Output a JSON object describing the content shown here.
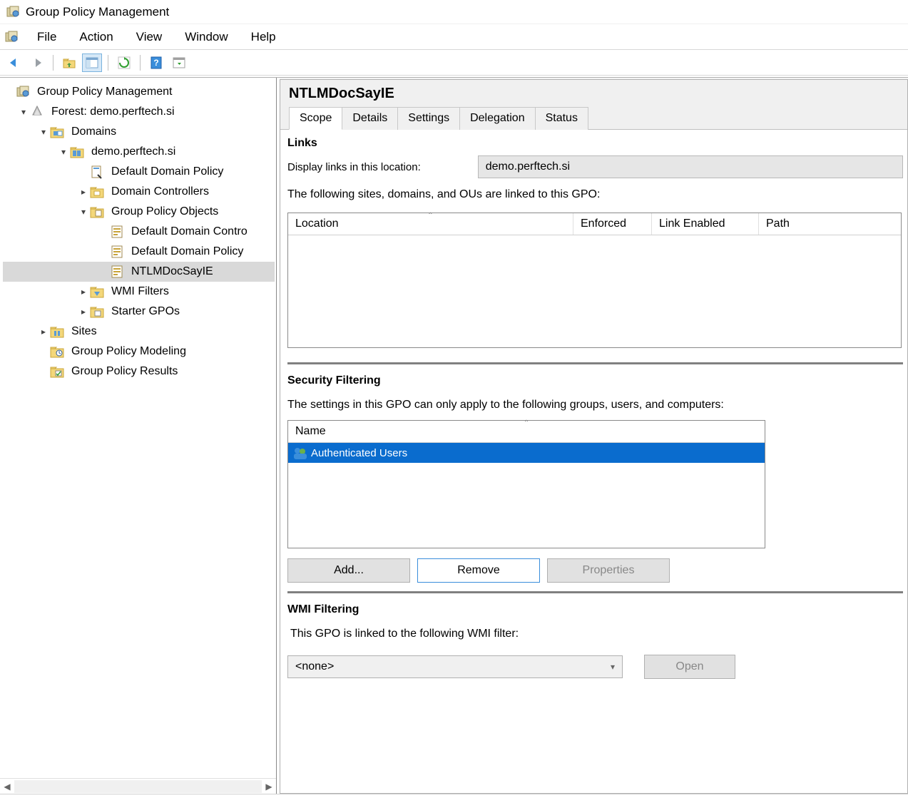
{
  "window": {
    "title": "Group Policy Management"
  },
  "menu": {
    "items": [
      "File",
      "Action",
      "View",
      "Window",
      "Help"
    ]
  },
  "tree": {
    "nodes": [
      {
        "indent": 0,
        "exp": "",
        "icon": "gpm",
        "label": "Group Policy Management",
        "sel": false
      },
      {
        "indent": 1,
        "exp": "▾",
        "icon": "forest",
        "label": "Forest: demo.perftech.si",
        "sel": false
      },
      {
        "indent": 2,
        "exp": "▾",
        "icon": "domains",
        "label": "Domains",
        "sel": false
      },
      {
        "indent": 3,
        "exp": "▾",
        "icon": "domain",
        "label": "demo.perftech.si",
        "sel": false
      },
      {
        "indent": 4,
        "exp": "",
        "icon": "gpo-link",
        "label": "Default Domain Policy",
        "sel": false
      },
      {
        "indent": 4,
        "exp": "▸",
        "icon": "ou",
        "label": "Domain Controllers",
        "sel": false
      },
      {
        "indent": 4,
        "exp": "▾",
        "icon": "gpo-folder",
        "label": "Group Policy Objects",
        "sel": false
      },
      {
        "indent": 5,
        "exp": "",
        "icon": "gpo",
        "label": "Default Domain Controllers Policy",
        "sel": false,
        "clip": "Default Domain Contro"
      },
      {
        "indent": 5,
        "exp": "",
        "icon": "gpo",
        "label": "Default Domain Policy",
        "sel": false
      },
      {
        "indent": 5,
        "exp": "",
        "icon": "gpo",
        "label": "NTLMDocSayIE",
        "sel": true
      },
      {
        "indent": 4,
        "exp": "▸",
        "icon": "wmi",
        "label": "WMI Filters",
        "sel": false
      },
      {
        "indent": 4,
        "exp": "▸",
        "icon": "starter",
        "label": "Starter GPOs",
        "sel": false
      },
      {
        "indent": 2,
        "exp": "▸",
        "icon": "sites",
        "label": "Sites",
        "sel": false
      },
      {
        "indent": 2,
        "exp": "",
        "icon": "modeling",
        "label": "Group Policy Modeling",
        "sel": false
      },
      {
        "indent": 2,
        "exp": "",
        "icon": "results",
        "label": "Group Policy Results",
        "sel": false
      }
    ]
  },
  "gpo": {
    "title": "NTLMDocSayIE",
    "tabs": [
      "Scope",
      "Details",
      "Settings",
      "Delegation",
      "Status"
    ],
    "activeTab": 0,
    "links": {
      "heading": "Links",
      "locationLabel": "Display links in this location:",
      "locationValue": "demo.perftech.si",
      "desc": "The following sites, domains, and OUs are linked to this GPO:",
      "columns": [
        "Location",
        "Enforced",
        "Link Enabled",
        "Path"
      ]
    },
    "security": {
      "heading": "Security Filtering",
      "desc": "The settings in this GPO can only apply to the following groups, users, and computers:",
      "col": "Name",
      "rows": [
        "Authenticated Users"
      ],
      "buttons": {
        "add": "Add...",
        "remove": "Remove",
        "props": "Properties"
      }
    },
    "wmi": {
      "heading": "WMI Filtering",
      "desc": "This GPO is linked to the following WMI filter:",
      "value": "<none>",
      "open": "Open"
    }
  }
}
